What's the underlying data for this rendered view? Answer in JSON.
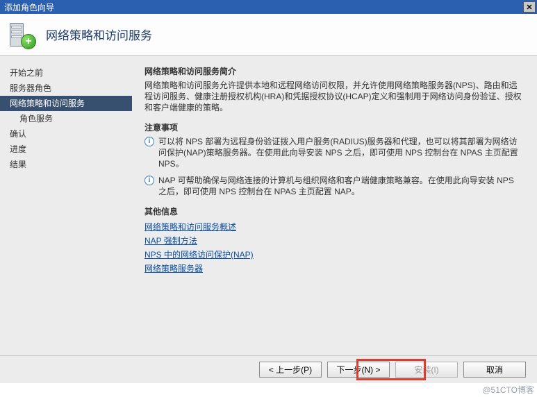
{
  "window": {
    "title": "添加角色向导"
  },
  "header": {
    "page_title": "网络策略和访问服务"
  },
  "sidebar": {
    "items": [
      {
        "label": "开始之前",
        "selected": false,
        "indent": false
      },
      {
        "label": "服务器角色",
        "selected": false,
        "indent": false
      },
      {
        "label": "网络策略和访问服务",
        "selected": true,
        "indent": false
      },
      {
        "label": "角色服务",
        "selected": false,
        "indent": true
      },
      {
        "label": "确认",
        "selected": false,
        "indent": false
      },
      {
        "label": "进度",
        "selected": false,
        "indent": false
      },
      {
        "label": "结果",
        "selected": false,
        "indent": false
      }
    ]
  },
  "content": {
    "intro_title": "网络策略和访问服务简介",
    "intro_text": "网络策略和访问服务允许提供本地和远程网络访问权限，并允许使用网络策略服务器(NPS)、路由和远程访问服务、健康注册授权机构(HRA)和凭据授权协议(HCAP)定义和强制用于网络访问身份验证、授权和客户端健康的策略。",
    "notes_title": "注意事项",
    "notes": [
      "可以将 NPS 部署为远程身份验证拨入用户服务(RADIUS)服务器和代理，也可以将其部署为网络访问保护(NAP)策略服务器。在使用此向导安装 NPS 之后，即可使用 NPS 控制台在 NPAS 主页配置 NPS。",
      "NAP 可帮助确保与网络连接的计算机与组织网络和客户端健康策略兼容。在使用此向导安装 NPS 之后，即可使用 NPS 控制台在 NPAS 主页配置 NAP。"
    ],
    "other_title": "其他信息",
    "links": [
      "网络策略和访问服务概述",
      "NAP 强制方法",
      "NPS 中的网络访问保护(NAP)",
      "网络策略服务器"
    ]
  },
  "footer": {
    "prev": "< 上一步(P)",
    "next": "下一步(N) >",
    "install": "安装(I)",
    "cancel": "取消"
  },
  "watermark": "@51CTO博客"
}
